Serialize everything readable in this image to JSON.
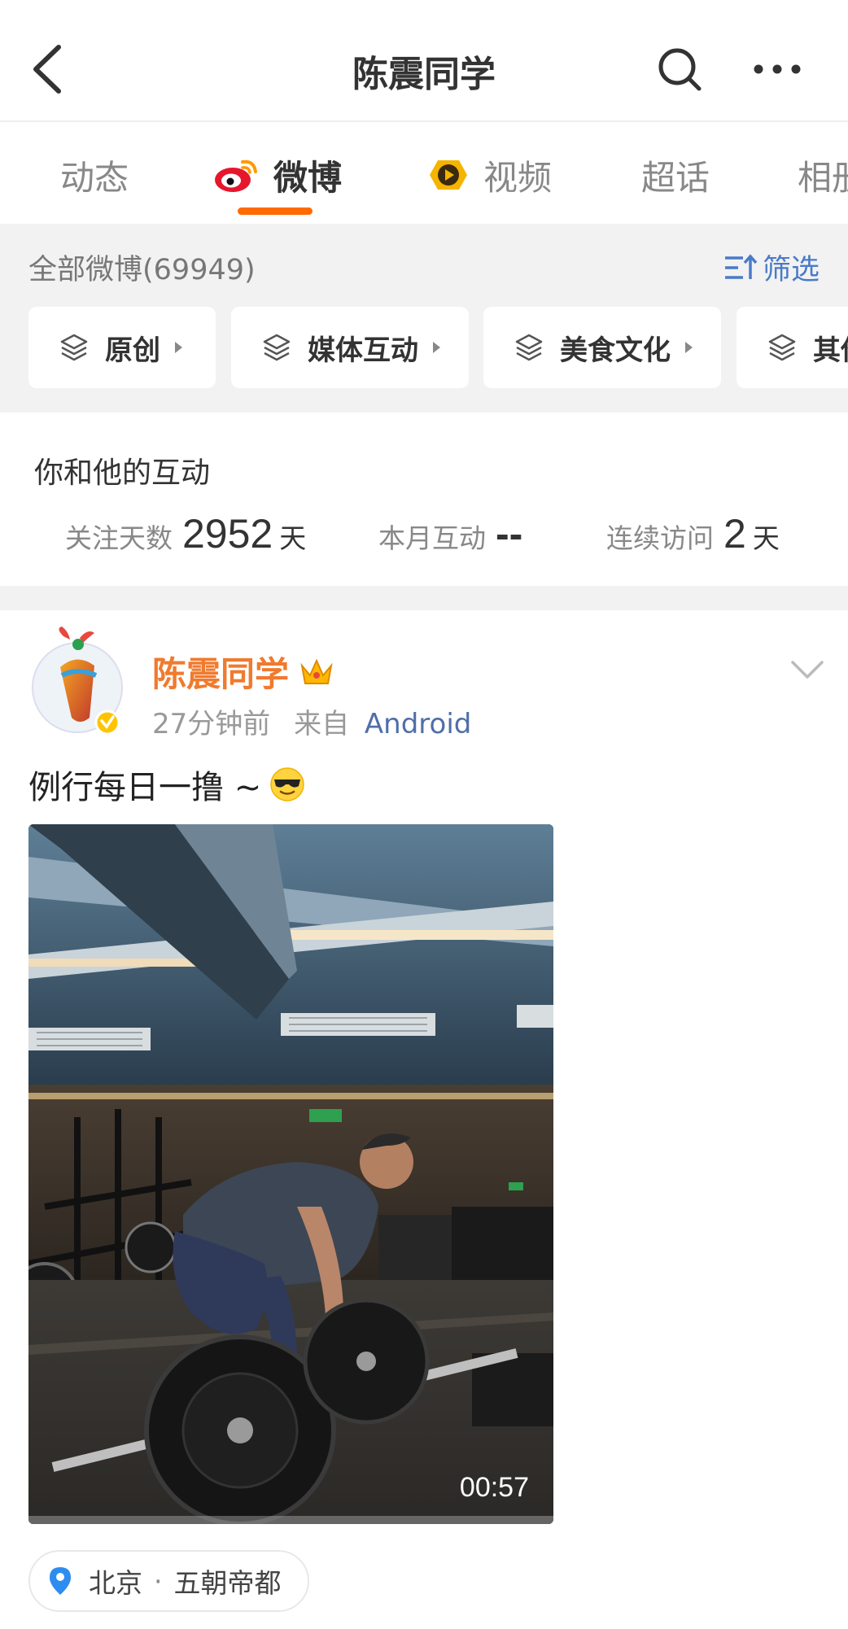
{
  "header": {
    "title": "陈震同学"
  },
  "tabs": [
    {
      "label": "动态",
      "icon": null
    },
    {
      "label": "微博",
      "icon": "weibo-logo-icon",
      "active": true
    },
    {
      "label": "视频",
      "icon": "video-logo-icon"
    },
    {
      "label": "超话",
      "icon": null
    },
    {
      "label": "相册",
      "icon": null
    }
  ],
  "filter": {
    "all_label": "全部微博(69949)",
    "filter_label": "筛选",
    "chips": [
      {
        "label": "原创"
      },
      {
        "label": "媒体互动"
      },
      {
        "label": "美食文化"
      },
      {
        "label": "其他"
      }
    ]
  },
  "interaction": {
    "title": "你和他的互动",
    "stats": [
      {
        "label": "关注天数",
        "value": "2952",
        "unit": "天"
      },
      {
        "label": "本月互动",
        "value": "--",
        "unit": ""
      },
      {
        "label": "连续访问",
        "value": "2",
        "unit": "天"
      }
    ]
  },
  "post": {
    "author": "陈震同学",
    "time": "27分钟前",
    "from_label": "来自",
    "source": "Android",
    "text": "例行每日一撸 ~",
    "video_duration": "00:57",
    "location_city": "北京",
    "location_separator": "·",
    "location_name": "五朝帝都"
  },
  "colors": {
    "accent": "#ff6b00",
    "author": "#f07a2e",
    "link": "#4a7bc8"
  }
}
